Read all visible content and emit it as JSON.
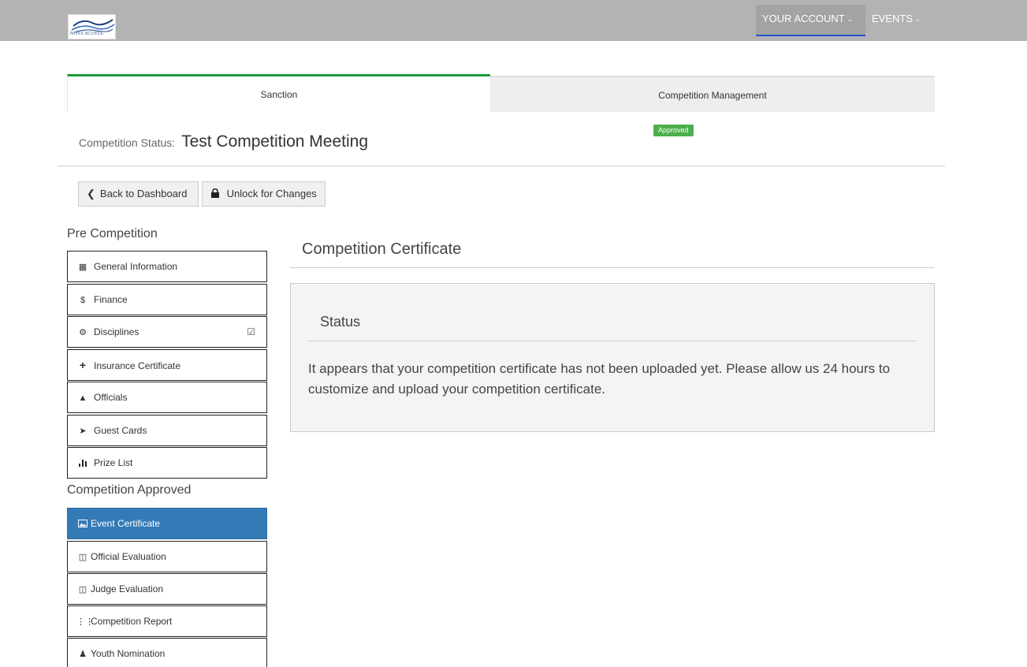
{
  "header": {
    "logo_text": "NOVA SCOTIA",
    "nav": [
      {
        "label": "YOUR ACCOUNT"
      },
      {
        "label": "EVENTS"
      }
    ]
  },
  "tabs": [
    {
      "label": "Sanction",
      "active": true
    },
    {
      "label": "Competition Management",
      "active": false
    }
  ],
  "status": {
    "label": "Competition Status:",
    "title": "Test Competition Meeting",
    "badge": "Approved"
  },
  "actions": {
    "back_label": "Back to Dashboard",
    "unlock_label": "Unlock for Changes"
  },
  "sidebar": {
    "pre_heading": "Pre Competition",
    "pre_items": [
      {
        "label": "General Information",
        "icon": "calendar-icon"
      },
      {
        "label": "Finance",
        "icon": "dollar-icon"
      },
      {
        "label": "Disciplines",
        "icon": "cog-icon",
        "checked": true
      },
      {
        "label": "Insurance Certificate",
        "icon": "plus-icon"
      },
      {
        "label": "Officials",
        "icon": "bell-icon"
      },
      {
        "label": "Guest Cards",
        "icon": "tags-icon"
      },
      {
        "label": "Prize List",
        "icon": "bar-chart-icon"
      }
    ],
    "approved_heading": "Competition Approved",
    "approved_items": [
      {
        "label": "Event Certificate",
        "icon": "picture-icon",
        "active": true
      },
      {
        "label": "Official Evaluation",
        "icon": "evaluation-icon"
      },
      {
        "label": "Judge Evaluation",
        "icon": "evaluation-icon"
      },
      {
        "label": "Competition Report",
        "icon": "report-icon"
      },
      {
        "label": "Youth Nomination",
        "icon": "nomination-icon"
      }
    ]
  },
  "main": {
    "title": "Competition Certificate",
    "panel_title": "Status",
    "panel_text": "It appears that your competition certificate has not been uploaded yet. Please allow us 24 hours to customize and upload your competition certificate."
  },
  "colors": {
    "topbar": "#b3b3b3",
    "active_tab_border": "#1a9a3a",
    "badge": "#4cae4c",
    "active_item": "#337ab7"
  }
}
